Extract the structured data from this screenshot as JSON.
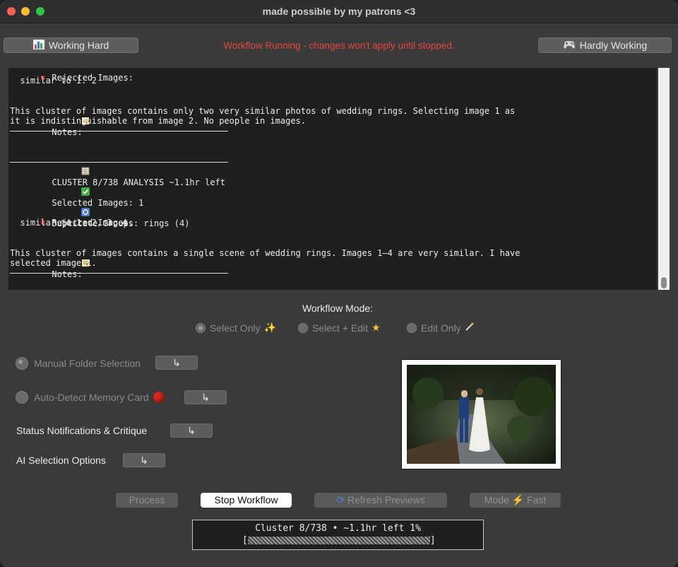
{
  "window": {
    "title": "made possible by my patrons <3"
  },
  "header": {
    "left_button": {
      "icon": "bar-chart-icon",
      "label": "Working Hard"
    },
    "status_warning": "Workflow Running - changes won't apply until stopped.",
    "right_button": {
      "icon": "game-controller-icon",
      "label": "Hardly Working"
    },
    "warning_color": "#e8453c"
  },
  "log": {
    "lines": {
      "partial_rejected": "Rejected Images:",
      "similar_prev": "  similar to 1: 2",
      "notes1_label": "Notes:",
      "notes1_text_a": "This cluster of images contains only two very similar photos of wedding rings. Selecting image 1 as",
      "notes1_text_b": "it is indistinguishable from image 2. No people in images.",
      "cluster_header": "CLUSTER 8/738 ANALYSIS ~1.1hr left",
      "selected": "Selected Images: 1",
      "duplicates": "Duplicate Groups: rings (4)",
      "rejected": "Rejected Images:",
      "similar": "  similar to 1: 2, 3, 4",
      "notes2_label": "Notes:",
      "notes2_text_a": "This cluster of images contains a single scene of wedding rings. Images 1–4 are very similar. I have",
      "notes2_text_b": "selected image 1."
    }
  },
  "workflow_mode": {
    "label": "Workflow Mode:",
    "options": [
      {
        "label": "Select Only",
        "icon": "sparkles-icon",
        "selected": true
      },
      {
        "label": "Select + Edit",
        "icon": "star-icon",
        "selected": false
      },
      {
        "label": "Edit Only",
        "icon": "magic-wand-icon",
        "selected": false
      }
    ]
  },
  "options": {
    "manual_folder": {
      "label": "Manual Folder Selection",
      "button": "↳"
    },
    "auto_detect": {
      "label": "Auto-Detect Memory Card",
      "button": "↳"
    },
    "status_notifications": {
      "label": "Status Notifications & Critique",
      "button": "↳"
    },
    "ai_selection": {
      "label": "AI Selection Options",
      "button": "↳"
    }
  },
  "bottom_buttons": {
    "b1": "Process",
    "stop": "Stop Workflow",
    "b3": "Refresh Previews",
    "b4": "Mode ⚡ Fast"
  },
  "progress": {
    "text": "Cluster 8/738 • ~1.1hr left 1%",
    "open_bracket": "[",
    "close_bracket": "]",
    "percent": 1
  }
}
